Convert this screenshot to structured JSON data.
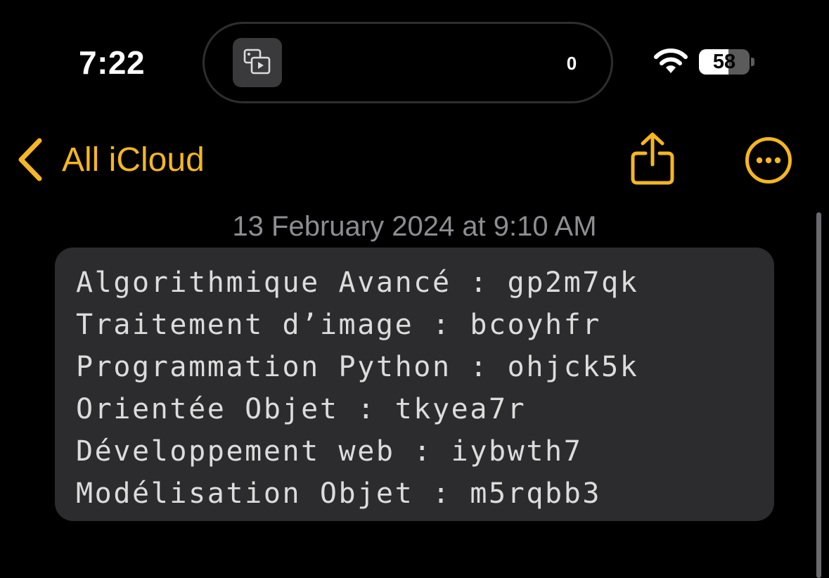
{
  "status_bar": {
    "time": "7:22",
    "activity_count": "0",
    "battery_level": "58",
    "battery_fraction": 0.58,
    "icons": [
      "screen-mirroring-icon",
      "wifi-icon",
      "battery-icon"
    ]
  },
  "nav": {
    "back_label": "All iCloud",
    "icons": [
      "chevron-left-icon",
      "share-icon",
      "more-icon"
    ]
  },
  "note": {
    "date": "13 February 2024 at 9:10 AM",
    "lines": [
      "Algorithmique Avancé : gp2m7qk",
      "Traitement d’image : bcoyhfr",
      "Programmation Python : ohjck5k",
      "Orientée Objet : tkyea7r",
      "Développement web : iybwth7",
      "Modélisation Objet : m5rqbb3"
    ]
  },
  "colors": {
    "accent": "#f5b621",
    "background": "#000000",
    "code_background": "#2c2c2e",
    "secondary_text": "#8d8d92"
  }
}
